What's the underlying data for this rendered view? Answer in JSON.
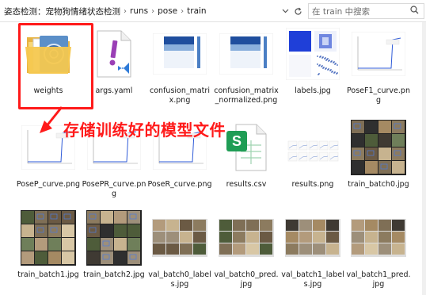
{
  "address_bar": {
    "crumbs": [
      "姿态检测：宠物狗情绪状态检测",
      "runs",
      "pose",
      "train"
    ],
    "dropdown_icon": "chevron-down-icon",
    "refresh_icon": "refresh-icon",
    "search_placeholder": "在 train 中搜索",
    "search_icon": "search-icon"
  },
  "annotation": {
    "text": "存储训练好的模型文件",
    "color": "#ff1a1a"
  },
  "files": [
    {
      "name": "weights",
      "kind": "folder"
    },
    {
      "name": "args.yaml",
      "kind": "yaml"
    },
    {
      "name": "confusion_matrix.png",
      "kind": "confusion"
    },
    {
      "name": "confusion_matrix_normalized.png",
      "kind": "confusion"
    },
    {
      "name": "labels.jpg",
      "kind": "labels"
    },
    {
      "name": "PoseF1_curve.png",
      "kind": "curve"
    },
    {
      "name": "PoseP_curve.png",
      "kind": "curve"
    },
    {
      "name": "PosePR_curve.png",
      "kind": "curve"
    },
    {
      "name": "PoseR_curve.png",
      "kind": "curve"
    },
    {
      "name": "results.csv",
      "kind": "csv"
    },
    {
      "name": "results.png",
      "kind": "results"
    },
    {
      "name": "train_batch0.jpg",
      "kind": "photos"
    },
    {
      "name": "train_batch1.jpg",
      "kind": "photos"
    },
    {
      "name": "train_batch2.jpg",
      "kind": "photos"
    },
    {
      "name": "val_batch0_labels.jpg",
      "kind": "photos"
    },
    {
      "name": "val_batch0_pred.jpg",
      "kind": "photos"
    },
    {
      "name": "val_batch1_labels.jpg",
      "kind": "photos"
    },
    {
      "name": "val_batch1_pred.jpg",
      "kind": "photos"
    }
  ]
}
